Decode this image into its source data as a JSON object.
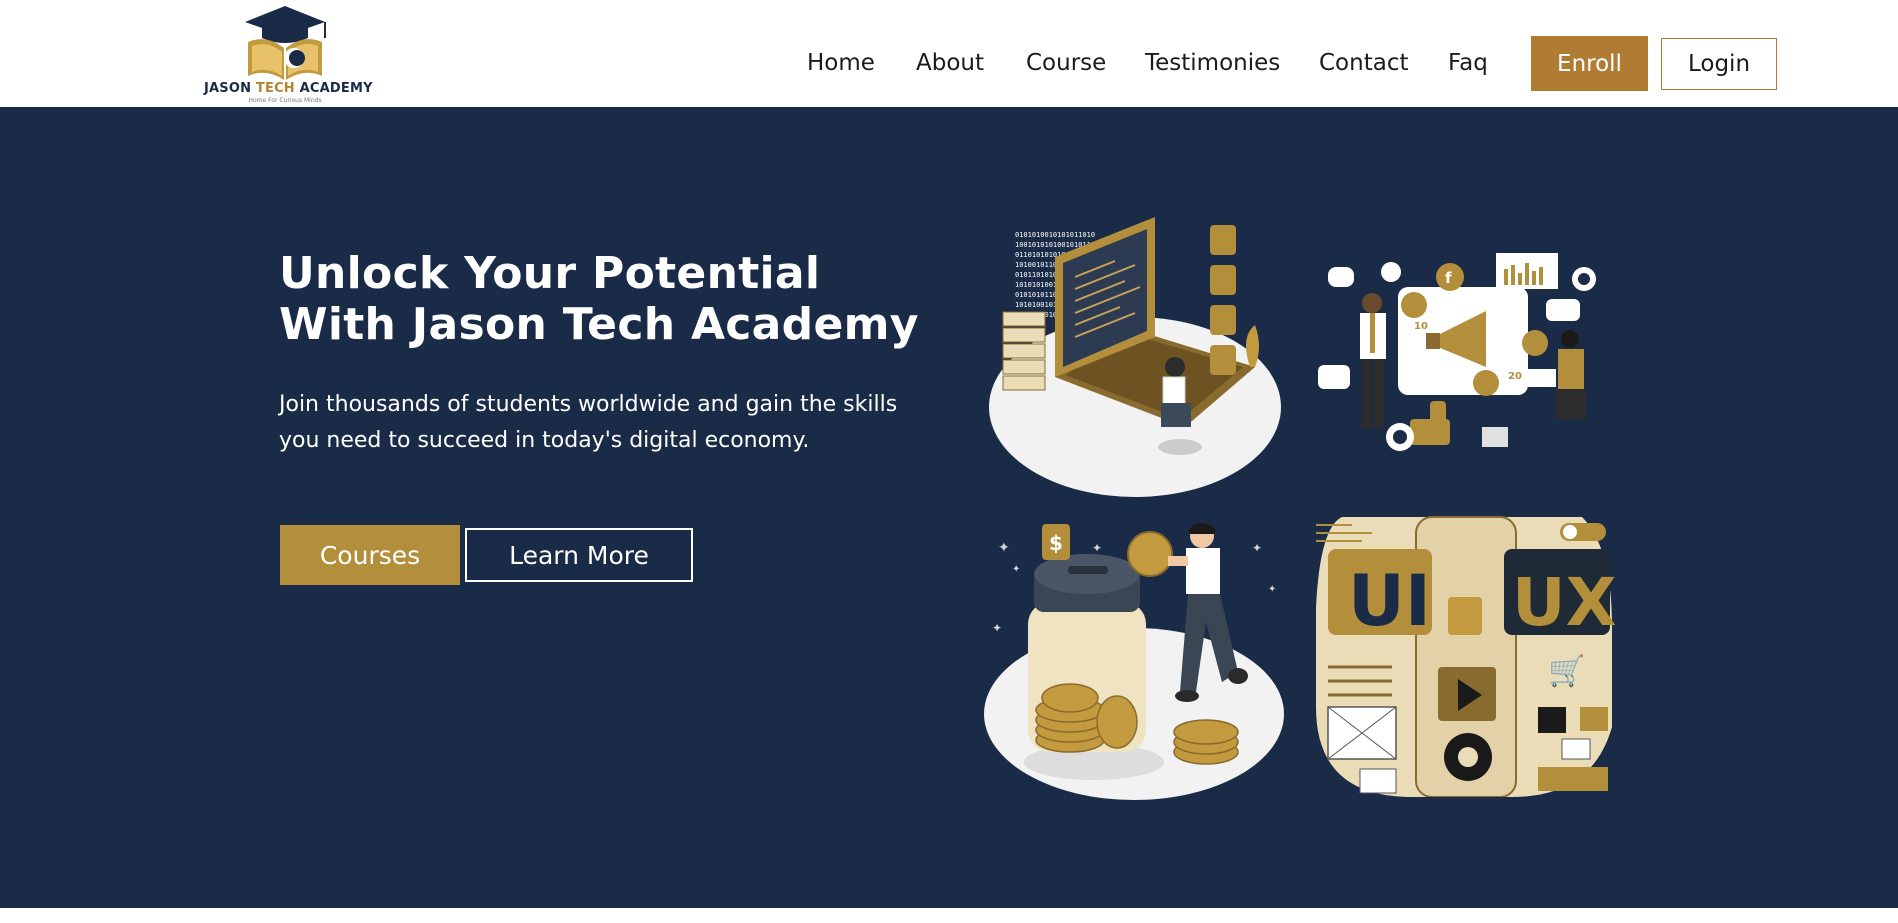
{
  "brand": {
    "name_part1": "JASON ",
    "name_part2": "TECH",
    "name_part3": " ACADEMY",
    "tagline": "Home For Curious Minds"
  },
  "nav": {
    "items": [
      {
        "label": "Home"
      },
      {
        "label": "About"
      },
      {
        "label": "Course"
      },
      {
        "label": "Testimonies"
      },
      {
        "label": "Contact"
      },
      {
        "label": "Faq"
      }
    ],
    "enroll_label": "Enroll",
    "login_label": "Login"
  },
  "hero": {
    "title_line1": "Unlock Your Potential",
    "title_line2": "With Jason Tech Academy",
    "subtitle": "Join thousands of students worldwide and gain the skills you need to succeed in today's digital economy.",
    "courses_label": "Courses",
    "learn_more_label": "Learn More"
  },
  "illustrations": {
    "ux_left_text": "UI",
    "ux_right_text": "UX",
    "social_counts": [
      "10",
      "20"
    ]
  },
  "colors": {
    "navy": "#1a2b47",
    "gold": "#b38e3b",
    "gold_dark": "#b07c34"
  }
}
